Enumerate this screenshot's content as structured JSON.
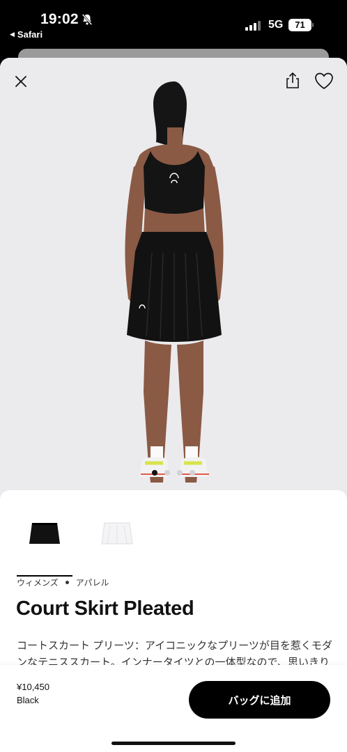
{
  "status_bar": {
    "time": "19:02",
    "back_app": "Safari",
    "network": "5G",
    "battery": "71",
    "icons": [
      "bell-slash-icon",
      "signal-icon",
      "battery-icon"
    ]
  },
  "header": {
    "icons": [
      "close-icon",
      "share-icon",
      "heart-icon"
    ]
  },
  "gallery": {
    "image_count": 4,
    "active_index": 0
  },
  "product": {
    "swatches": [
      {
        "name": "Black",
        "color": "#111111",
        "selected": true
      },
      {
        "name": "White",
        "color": "#f4f4f6",
        "selected": false
      }
    ],
    "category_gender": "ウィメンズ",
    "category_type": "アパレル",
    "title": "Court Skirt Pleated",
    "description": "コートスカート プリーツ：アイコニックなプリーツが目を惹くモダンなテニススカート。インナータイツとの一体型なので、思いきり"
  },
  "purchase": {
    "price": "¥10,450",
    "color_name": "Black",
    "add_to_bag_label": "バッグに追加"
  },
  "colors": {
    "accent": "#000000",
    "background": "#ebebee"
  }
}
